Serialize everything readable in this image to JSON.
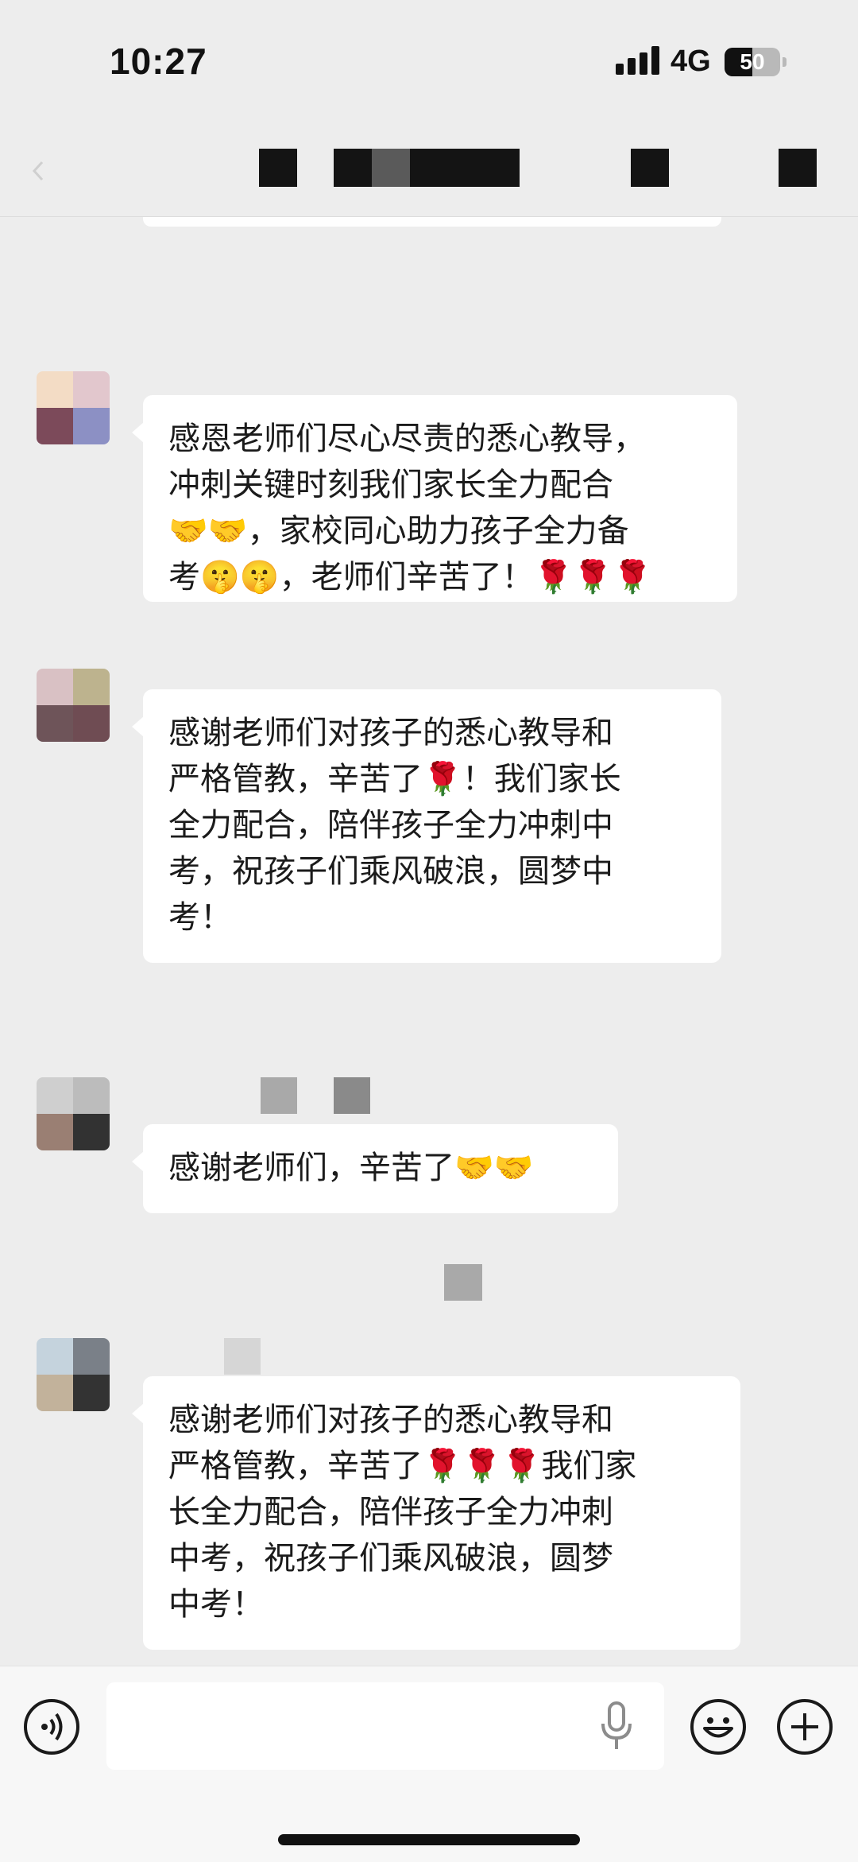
{
  "status_bar": {
    "time": "10:27",
    "network": "4G",
    "battery": "50",
    "battery_level": 0.5
  },
  "nav": {
    "back_icon": "chevron-left-icon",
    "title_redacted": true
  },
  "messages": [
    {
      "text": "感恩老师们尽心尽责的悉心教导，\n冲刺关键时刻我们家长全力配合\n🤝🤝，家校同心助力孩子全力备\n考🤫🤫，老师们辛苦了！🌹🌹🌹",
      "avatar_colors": [
        "#f3dcc5",
        "#e2c7cd",
        "#7c4a5a",
        "#8c90c4"
      ]
    },
    {
      "text": "感谢老师们对孩子的悉心教导和\n严格管教，辛苦了🌹！我们家长\n全力配合，陪伴孩子全力冲刺中\n考，祝孩子们乘风破浪，圆梦中\n考！",
      "avatar_colors": [
        "#d9c1c4",
        "#bdb38e",
        "#6e5459",
        "#6f4c53"
      ]
    },
    {
      "text": "感谢老师们，辛苦了🤝🤝",
      "avatar_colors": [
        "#cfcfcf",
        "#bcbcbc",
        "#9a7f73",
        "#323232"
      ]
    },
    {
      "text": "感谢老师们对孩子的悉心教导和\n严格管教，辛苦了🌹🌹🌹我们家\n长全力配合，陪伴孩子全力冲刺\n中考，祝孩子们乘风破浪，圆梦\n中考！",
      "avatar_colors": [
        "#c5d3dd",
        "#7a8088",
        "#c2b29b",
        "#333333"
      ]
    }
  ],
  "input_bar": {
    "voice_icon": "voice-icon",
    "input_value": "",
    "mic_icon": "microphone-icon",
    "emoji_icon": "emoji-icon",
    "plus_icon": "plus-icon"
  }
}
